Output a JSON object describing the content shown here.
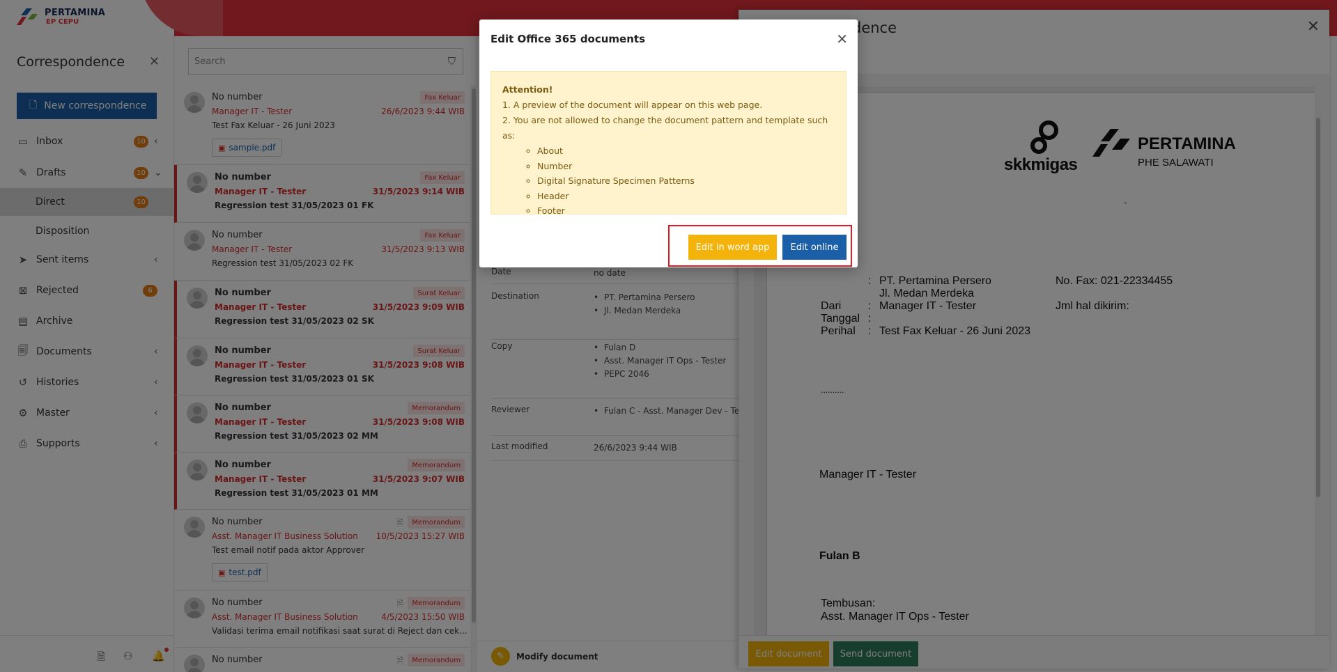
{
  "header": {
    "brand_name": "PERTAMINA",
    "brand_sub": "EP CEPU"
  },
  "sidebar": {
    "title": "Correspondence",
    "new_button": "New correspondence",
    "items": [
      {
        "label": "Inbox",
        "icon": "inbox-icon",
        "badge": "10",
        "chevron": "‹"
      },
      {
        "label": "Drafts",
        "icon": "drafts-icon",
        "badge": "10",
        "chevron": "⌄"
      },
      {
        "label": "Direct",
        "badge": "10"
      },
      {
        "label": "Disposition"
      },
      {
        "label": "Sent items",
        "icon": "sent-icon",
        "chevron": "‹"
      },
      {
        "label": "Rejected",
        "icon": "rejected-icon",
        "badge": "6"
      },
      {
        "label": "Archive",
        "icon": "archive-icon"
      },
      {
        "label": "Documents",
        "icon": "documents-icon",
        "chevron": "‹"
      },
      {
        "label": "Histories",
        "icon": "history-icon",
        "chevron": "‹"
      },
      {
        "label": "Master",
        "icon": "master-icon",
        "chevron": "‹"
      },
      {
        "label": "Supports",
        "icon": "supports-icon",
        "chevron": "‹"
      }
    ]
  },
  "list": {
    "search_placeholder": "Search",
    "items": [
      {
        "number": "No number",
        "sender": "Manager IT - Tester",
        "subject": "Test Fax Keluar - 26 Juni 2023",
        "tag": "Fax Keluar",
        "date": "26/6/2023 9:44 WIB",
        "file": "sample.pdf"
      },
      {
        "number": "No number",
        "sender": "Manager IT - Tester",
        "subject": "Regression test 31/05/2023 01 FK",
        "tag": "Fax Keluar",
        "date": "31/5/2023 9:14 WIB"
      },
      {
        "number": "No number",
        "sender": "Manager IT - Tester",
        "subject": "Regression test 31/05/2023 02 FK",
        "tag": "Fax Keluar",
        "date": "31/5/2023 9:13 WIB"
      },
      {
        "number": "No number",
        "sender": "Manager IT - Tester",
        "subject": "Regression test 31/05/2023 02 SK",
        "tag": "Surat Keluar",
        "date": "31/5/2023 9:09 WIB"
      },
      {
        "number": "No number",
        "sender": "Manager IT - Tester",
        "subject": "Regression test 31/05/2023 01 SK",
        "tag": "Surat Keluar",
        "date": "31/5/2023 9:08 WIB"
      },
      {
        "number": "No number",
        "sender": "Manager IT - Tester",
        "subject": "Regression test 31/05/2023 02 MM",
        "tag": "Memorandum",
        "date": "31/5/2023 9:08 WIB"
      },
      {
        "number": "No number",
        "sender": "Manager IT - Tester",
        "subject": "Regression test 31/05/2023 01 MM",
        "tag": "Memorandum",
        "date": "31/5/2023 9:07 WIB"
      },
      {
        "number": "No number",
        "sender": "Asst. Manager IT Business Solution",
        "subject": "Test email notif pada aktor Approver",
        "tag": "Memorandum",
        "date": "10/5/2023 15:27 WIB",
        "file": "test.pdf"
      },
      {
        "number": "No number",
        "sender": "Asst. Manager IT Business Solution",
        "subject": "Validasi terima email notifikasi saat surat di Reject dan cek...",
        "tag": "Memorandum",
        "date": "4/5/2023 15:50 WIB"
      },
      {
        "number": "No number",
        "tag": "Memorandum"
      }
    ]
  },
  "detail": {
    "date_label": "Date",
    "date_value": "no date",
    "destination_label": "Destination",
    "destination": [
      "PT. Pertamina Persero",
      "Jl. Medan Merdeka"
    ],
    "copy_label": "Copy",
    "copy": [
      "Fulan D",
      "Asst. Manager IT Ops - Tester",
      "PEPC 2046"
    ],
    "reviewer_label": "Reviewer",
    "reviewer": "Fulan C - Asst. Manager Dev - Test",
    "modified_label": "Last modified",
    "modified_value": "26/6/2023 9:44 WIB",
    "modify_label": "Modify document"
  },
  "preview": {
    "title_fragment": "dence",
    "logo_left": "skkmigas",
    "logo_right": "PERTAMINA",
    "logo_right_sub": "PHE SALAWATI",
    "dash": "-",
    "to_value": "PT. Pertamina Persero",
    "to_value_2": "Jl. Medan Merdeka",
    "fax_no": "No. Fax: 021-22334455",
    "from_label": "Dari",
    "from_value": "Manager IT - Tester",
    "pages_label": "Jml hal dikirim:",
    "date_label": "Tanggal",
    "subject_label": "Perihal",
    "subject_value": "Test Fax Keluar - 26 Juni 2023",
    "colon": ":",
    "dots": "..........",
    "signer_title": "Manager IT - Tester",
    "signer_name": "Fulan B",
    "cc_label": "Tembusan:",
    "cc_value": "Asst. Manager IT Ops - Tester",
    "edit_button": "Edit document",
    "send_button": "Send document"
  },
  "modal": {
    "title": "Edit Office 365 documents",
    "attention": "Attention!",
    "line1": "1. A preview of the document will appear on this web page.",
    "line2": "2. You are not allowed to change the document pattern and template such as:",
    "bullets": [
      "About",
      "Number",
      "Digital Signature Specimen Patterns",
      "Header",
      "Footer"
    ],
    "word_button": "Edit in word app",
    "online_button": "Edit online"
  },
  "colors": {
    "brand_red": "#e0313a",
    "primary_blue": "#1b5fa8",
    "warning_yellow": "#f4b30a",
    "success_green": "#2f7a5a",
    "badge_orange": "#e07a16"
  }
}
